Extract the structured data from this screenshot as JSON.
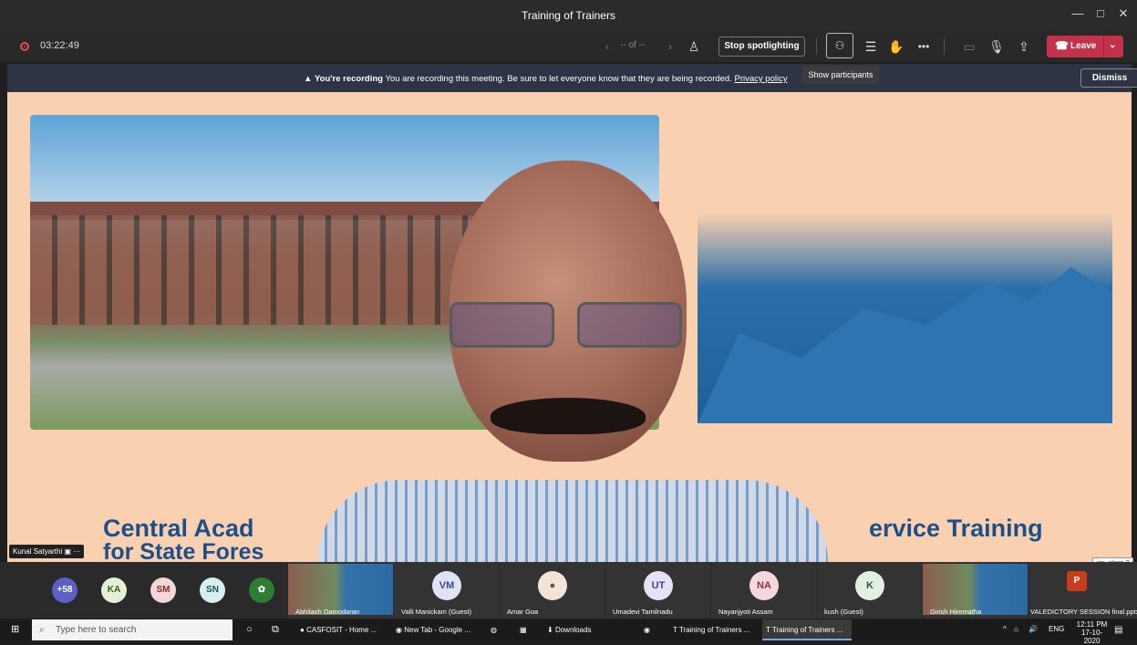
{
  "window": {
    "title": "Training of Trainers",
    "controls": [
      "—",
      "□",
      "✕"
    ]
  },
  "toolbar": {
    "timer": "03:22:49",
    "page_indicator": "-- of --",
    "stop_spotlight_label": "Stop spotlighting",
    "leave_label": "Leave",
    "tooltip": "Show participants"
  },
  "banner": {
    "title": "You're recording",
    "message": "You are recording this meeting. Be sure to let everyone know that they are being recorded.",
    "link": "Privacy policy",
    "dismiss_label": "Dismiss"
  },
  "slide": {
    "text_left": "Central Acad",
    "text_right": "ervice Training",
    "text_left2": "for State Fores"
  },
  "speaker_label": "Kunal Satyarthi",
  "gallery": {
    "overflow_count": "+58",
    "avatars": [
      {
        "initials": "KA",
        "color": "#e6f0d6",
        "fg": "#3b5a1c"
      },
      {
        "initials": "SM",
        "color": "#f5d6d6",
        "fg": "#7a2b2b"
      },
      {
        "initials": "SN",
        "color": "#d6eef0",
        "fg": "#1c4e56"
      }
    ],
    "tiles": [
      {
        "name": "Abhilash Damodaran"
      },
      {
        "name": "Valli Manickam (Guest)",
        "initials": "VM"
      },
      {
        "name": "Amar Goa"
      },
      {
        "name": "Umadevi Tamilnadu",
        "initials": "UT"
      },
      {
        "name": "Nayanjyoti Assam",
        "initials": "NA"
      },
      {
        "name": "kush (Guest)",
        "initials": "K"
      },
      {
        "name": "Girish Hirematha"
      },
      {
        "name": "VALEDICTORY SESSION final.pptx"
      }
    ],
    "close_tooltip": "icn_close-2"
  },
  "taskbar": {
    "search_placeholder": "Type here to search",
    "apps": [
      {
        "label": "CASFOSIT - Home ..."
      },
      {
        "label": "New Tab - Google ..."
      },
      {
        "label": "Downloads"
      },
      {
        "label": "Training of Trainers ..."
      },
      {
        "label": "Training of Trainers ..."
      }
    ],
    "lang": "ENG",
    "time": "12:11 PM",
    "date": "17-10-2020"
  }
}
